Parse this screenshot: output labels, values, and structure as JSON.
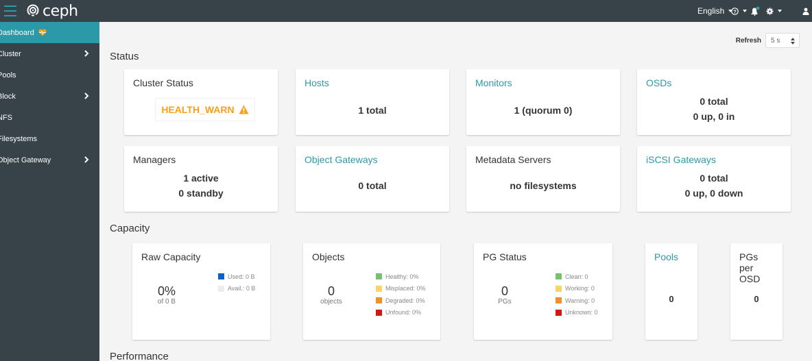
{
  "topbar": {
    "brand": "ceph",
    "language": "English",
    "icons": [
      "menu-icon",
      "ceph-logo-icon",
      "bell-icon",
      "help-icon",
      "gear-icon",
      "user-icon"
    ]
  },
  "sidebar": {
    "items": [
      {
        "label": "Dashboard",
        "active": true,
        "has_submenu": false
      },
      {
        "label": "Cluster",
        "active": false,
        "has_submenu": true
      },
      {
        "label": "Pools",
        "active": false,
        "has_submenu": false
      },
      {
        "label": "Block",
        "active": false,
        "has_submenu": true
      },
      {
        "label": "NFS",
        "active": false,
        "has_submenu": false
      },
      {
        "label": "Filesystems",
        "active": false,
        "has_submenu": false
      },
      {
        "label": "Object Gateway",
        "active": false,
        "has_submenu": true
      }
    ]
  },
  "refresh": {
    "label": "Refresh",
    "value": "5 s"
  },
  "status": {
    "title": "Status",
    "cards": {
      "cluster_status": {
        "title": "Cluster Status",
        "value": "HEALTH_WARN"
      },
      "hosts": {
        "title": "Hosts",
        "line1": "1 total"
      },
      "monitors": {
        "title": "Monitors",
        "line1": "1 (quorum 0)"
      },
      "osds": {
        "title": "OSDs",
        "line1": "0 total",
        "line2": "0 up, 0 in"
      },
      "managers": {
        "title": "Managers",
        "line1": "1 active",
        "line2": "0 standby"
      },
      "object_gateways": {
        "title": "Object Gateways",
        "line1": "0 total"
      },
      "metadata_servers": {
        "title": "Metadata Servers",
        "line1": "no filesystems"
      },
      "iscsi_gateways": {
        "title": "iSCSI Gateways",
        "line1": "0 total",
        "line2": "0 up, 0 down"
      }
    }
  },
  "capacity": {
    "title": "Capacity",
    "raw_capacity": {
      "title": "Raw Capacity",
      "value": "0%",
      "sub": "of 0 B",
      "legend": [
        {
          "label": "Used: 0 B",
          "color": "#0b62c4"
        },
        {
          "label": "Avail.: 0 B",
          "color": "#ececec"
        }
      ]
    },
    "objects": {
      "title": "Objects",
      "value": "0",
      "sub": "objects",
      "legend": [
        {
          "label": "Healthy: 0%",
          "color": "#77c071"
        },
        {
          "label": "Misplaced: 0%",
          "color": "#f9d46b"
        },
        {
          "label": "Degraded: 0%",
          "color": "#f0902b"
        },
        {
          "label": "Unfound: 0%",
          "color": "#cc1b14"
        }
      ]
    },
    "pg_status": {
      "title": "PG Status",
      "value": "0",
      "sub": "PGs",
      "legend": [
        {
          "label": "Clean: 0",
          "color": "#77c071"
        },
        {
          "label": "Working: 0",
          "color": "#f9d46b"
        },
        {
          "label": "Warning: 0",
          "color": "#f0902b"
        },
        {
          "label": "Unknown: 0",
          "color": "#cc1b14"
        }
      ]
    },
    "pools": {
      "title": "Pools",
      "value": "0"
    },
    "pgs_per_osd": {
      "title_lines": [
        "PGs",
        "per",
        "OSD"
      ],
      "value": "0"
    }
  },
  "performance": {
    "title": "Performance"
  },
  "colors": {
    "accent": "#2b99a8",
    "nav_bg": "#374249",
    "warn": "#f6a01a"
  }
}
